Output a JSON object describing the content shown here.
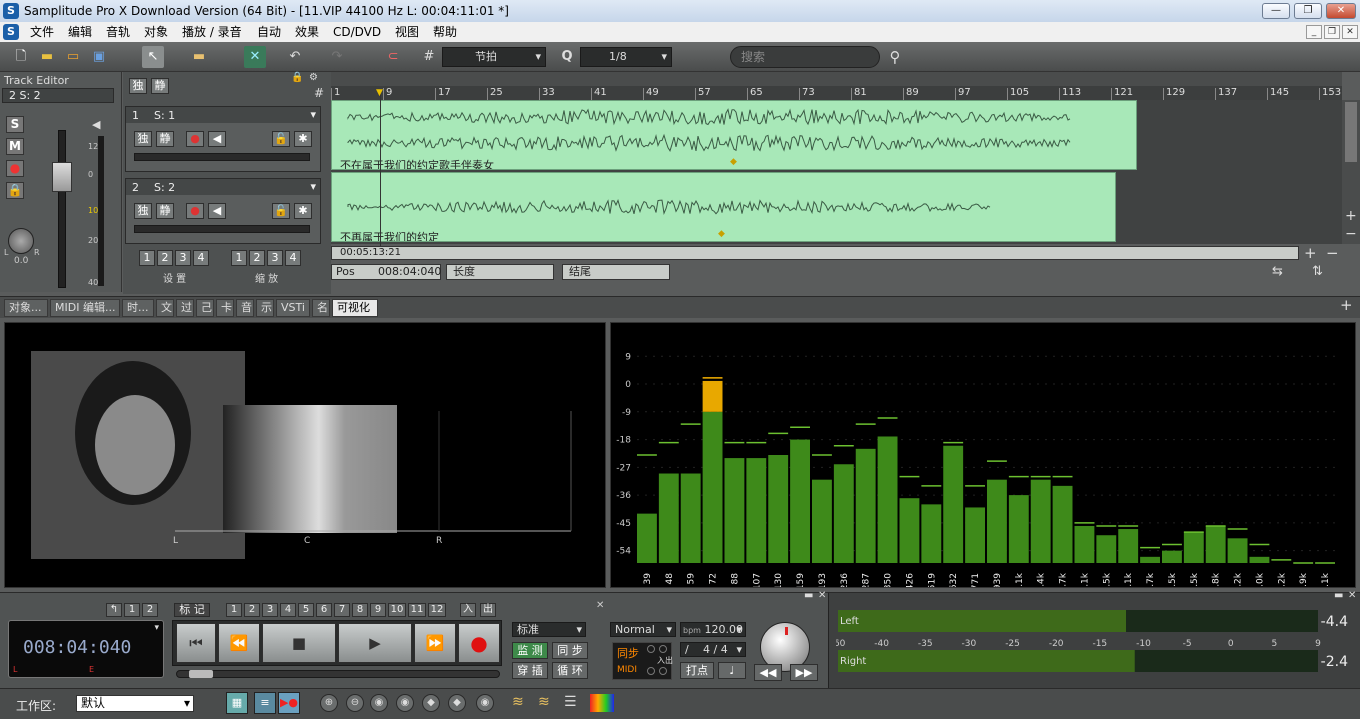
{
  "window": {
    "title": "Samplitude Pro X Download Version (64 Bit) - [11.VIP    44100 Hz L: 00:04:11:01 *]"
  },
  "menu": [
    "文件",
    "编辑",
    "音轨",
    "对象",
    "播放 / 录音",
    "自动",
    "效果",
    "CD/DVD",
    "视图",
    "帮助"
  ],
  "toolbar": {
    "snap_label": "节拍",
    "quantize_prefix": "Q",
    "quantize_value": "1/8",
    "search_placeholder": "搜索"
  },
  "track_editor": {
    "title": "Track Editor",
    "current": "2    S: 2",
    "solo": "独",
    "mute": "静",
    "s_btn": "S",
    "m_btn": "M",
    "fader_scale": [
      "12",
      "0",
      "10",
      "20",
      "40"
    ],
    "pan_l": "L",
    "pan_r": "R",
    "pan_value": "0.0"
  },
  "tracks": [
    {
      "num": "1",
      "name": "S: 1",
      "solo": "独",
      "mute": "静",
      "clip_label": "不在属于我们的约定歌手伴奏女"
    },
    {
      "num": "2",
      "name": "S: 2",
      "solo": "独",
      "mute": "静",
      "clip_label": "不再属于我们的约定"
    }
  ],
  "track_footer": {
    "settings_nums": [
      "1",
      "2",
      "3",
      "4"
    ],
    "settings_label": "设 置",
    "zoom_nums": [
      "1",
      "2",
      "3",
      "4"
    ],
    "zoom_label": "缩 放"
  },
  "ruler": [
    "1",
    "9",
    "17",
    "25",
    "33",
    "41",
    "49",
    "57",
    "65",
    "73",
    "81",
    "89",
    "97",
    "105",
    "113",
    "121",
    "129",
    "137",
    "145",
    "153"
  ],
  "timeline": {
    "scroll_time": "00:05:13:21",
    "pos_label": "Pos",
    "pos_value": "008:04:040",
    "length_label": "长度",
    "end_label": "结尾"
  },
  "tabs": [
    {
      "label": "对象...",
      "active": false
    },
    {
      "label": "MIDI 编辑...",
      "active": false
    },
    {
      "label": "时...",
      "active": false
    },
    {
      "label": "文",
      "active": false
    },
    {
      "label": "过",
      "active": false
    },
    {
      "label": "己",
      "active": false
    },
    {
      "label": "卡",
      "active": false
    },
    {
      "label": "音",
      "active": false
    },
    {
      "label": "示",
      "active": false
    },
    {
      "label": "VSTi",
      "active": false
    },
    {
      "label": "名",
      "active": false
    },
    {
      "label": "可视化",
      "active": true
    }
  ],
  "vectorscope": {
    "labels": [
      "L",
      "C",
      "R"
    ]
  },
  "spectrum": {
    "y_ticks": [
      "9",
      "0",
      "-9",
      "-18",
      "-27",
      "-36",
      "-45",
      "-54"
    ],
    "y_range": [
      -58,
      12
    ],
    "bands": [
      {
        "f": "39",
        "v": -42,
        "peak": -23
      },
      {
        "f": "48",
        "v": -29,
        "peak": -19
      },
      {
        "f": "59",
        "v": -29,
        "peak": -13
      },
      {
        "f": "72",
        "v": -9,
        "peak": 2
      },
      {
        "f": "88",
        "v": -24,
        "peak": -19
      },
      {
        "f": "107",
        "v": -24,
        "peak": -19
      },
      {
        "f": "130",
        "v": -23,
        "peak": -16
      },
      {
        "f": "159",
        "v": -18,
        "peak": -14
      },
      {
        "f": "193",
        "v": -31,
        "peak": -23
      },
      {
        "f": "236",
        "v": -26,
        "peak": -20
      },
      {
        "f": "287",
        "v": -21,
        "peak": -13
      },
      {
        "f": "350",
        "v": -17,
        "peak": -11
      },
      {
        "f": "426",
        "v": -37,
        "peak": -30
      },
      {
        "f": "519",
        "v": -39,
        "peak": -33
      },
      {
        "f": "632",
        "v": -20,
        "peak": -19
      },
      {
        "f": "771",
        "v": -40,
        "peak": -33
      },
      {
        "f": "939",
        "v": -31,
        "peak": -25
      },
      {
        "f": "1.1k",
        "v": -36,
        "peak": -30
      },
      {
        "f": "1.4k",
        "v": -31,
        "peak": -30
      },
      {
        "f": "1.7k",
        "v": -33,
        "peak": -30
      },
      {
        "f": "2.1k",
        "v": -46,
        "peak": -45
      },
      {
        "f": "2.5k",
        "v": -49,
        "peak": -46
      },
      {
        "f": "3.1k",
        "v": -47,
        "peak": -46
      },
      {
        "f": "3.7k",
        "v": -56,
        "peak": -53
      },
      {
        "f": "4.5k",
        "v": -54,
        "peak": -52
      },
      {
        "f": "5.5k",
        "v": -48,
        "peak": -48
      },
      {
        "f": "6.8k",
        "v": -46,
        "peak": -46
      },
      {
        "f": "8.2k",
        "v": -50,
        "peak": -47
      },
      {
        "f": "10.0k",
        "v": -56,
        "peak": -52
      },
      {
        "f": "12.2k",
        "v": -58,
        "peak": -57
      },
      {
        "f": "14.9k",
        "v": -58,
        "peak": -58
      },
      {
        "f": "18.1k",
        "v": -58,
        "peak": -58
      }
    ]
  },
  "transport": {
    "undo_nums": [
      "1",
      "2"
    ],
    "marker_label": "标 记",
    "marker_nums": [
      "1",
      "2",
      "3",
      "4",
      "5",
      "6",
      "7",
      "8",
      "9",
      "10",
      "11",
      "12"
    ],
    "in_label": "入",
    "out_label": "出",
    "time": "008:04:040",
    "time_l": "L",
    "time_e": "E",
    "mode": "标准",
    "monitor": "监 测",
    "sync": "同 步",
    "punch": "穿 插",
    "loop": "循 环",
    "play_mode": "Normal",
    "bpm_prefix": "bpm",
    "bpm_value": "120.00",
    "sync_badge": "同步",
    "midi_badge": "MIDI",
    "in_small": "入",
    "out_small": "出",
    "meter_sig_prefix": "/",
    "meter_sig": "4 / 4",
    "tap": "打点"
  },
  "master_meter": {
    "left_label": "Left",
    "right_label": "Right",
    "scale": [
      "-60",
      "-40",
      "-35",
      "-30",
      "-25",
      "-20",
      "-15",
      "-10",
      "-5",
      "0",
      "5",
      "9"
    ],
    "left_peak": "-4.4",
    "right_peak": "-2.4",
    "left_level": -12,
    "right_level": -11
  },
  "bottom": {
    "workspace_label": "工作区:",
    "workspace_value": "默认"
  }
}
